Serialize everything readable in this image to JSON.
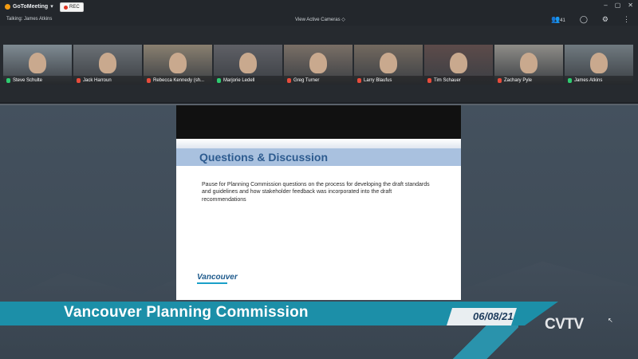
{
  "app": {
    "name": "GoToMeeting",
    "rec_label": "REC"
  },
  "window_controls": [
    "–",
    "▢",
    "✕"
  ],
  "toolbar": {
    "talking": "Talking: James Atkins",
    "view_cameras": "View Active Cameras ◇",
    "attendee_count": "41"
  },
  "participants": [
    {
      "name": "Steve Schulte",
      "mic": "on",
      "bg": "#7f8b93"
    },
    {
      "name": "Jack Harroun",
      "mic": "off",
      "bg": "#6b7176"
    },
    {
      "name": "Rebecca Kennedy (sh...",
      "mic": "off",
      "bg": "#8a8070"
    },
    {
      "name": "Marjorie Ledell",
      "mic": "on",
      "bg": "#5f6066"
    },
    {
      "name": "Greg Turner",
      "mic": "off",
      "bg": "#7a6f66"
    },
    {
      "name": "Larry Blaufus",
      "mic": "off",
      "bg": "#73695f"
    },
    {
      "name": "Tim Schauer",
      "mic": "off",
      "bg": "#5d4b4a"
    },
    {
      "name": "Zachary Pyle",
      "mic": "off",
      "bg": "#8f8d88"
    },
    {
      "name": "James Atkins",
      "mic": "on",
      "bg": "#707a80"
    }
  ],
  "slide": {
    "title": "Questions & Discussion",
    "body": "Pause for Planning Commission questions on the process for developing the draft standards and guidelines and how stakeholder feedback was incorporated into the draft recommendations",
    "logo_text": "Vancouver"
  },
  "banner": {
    "title": "Vancouver Planning Commission",
    "date": "06/08/21"
  },
  "channel": "CVTV"
}
